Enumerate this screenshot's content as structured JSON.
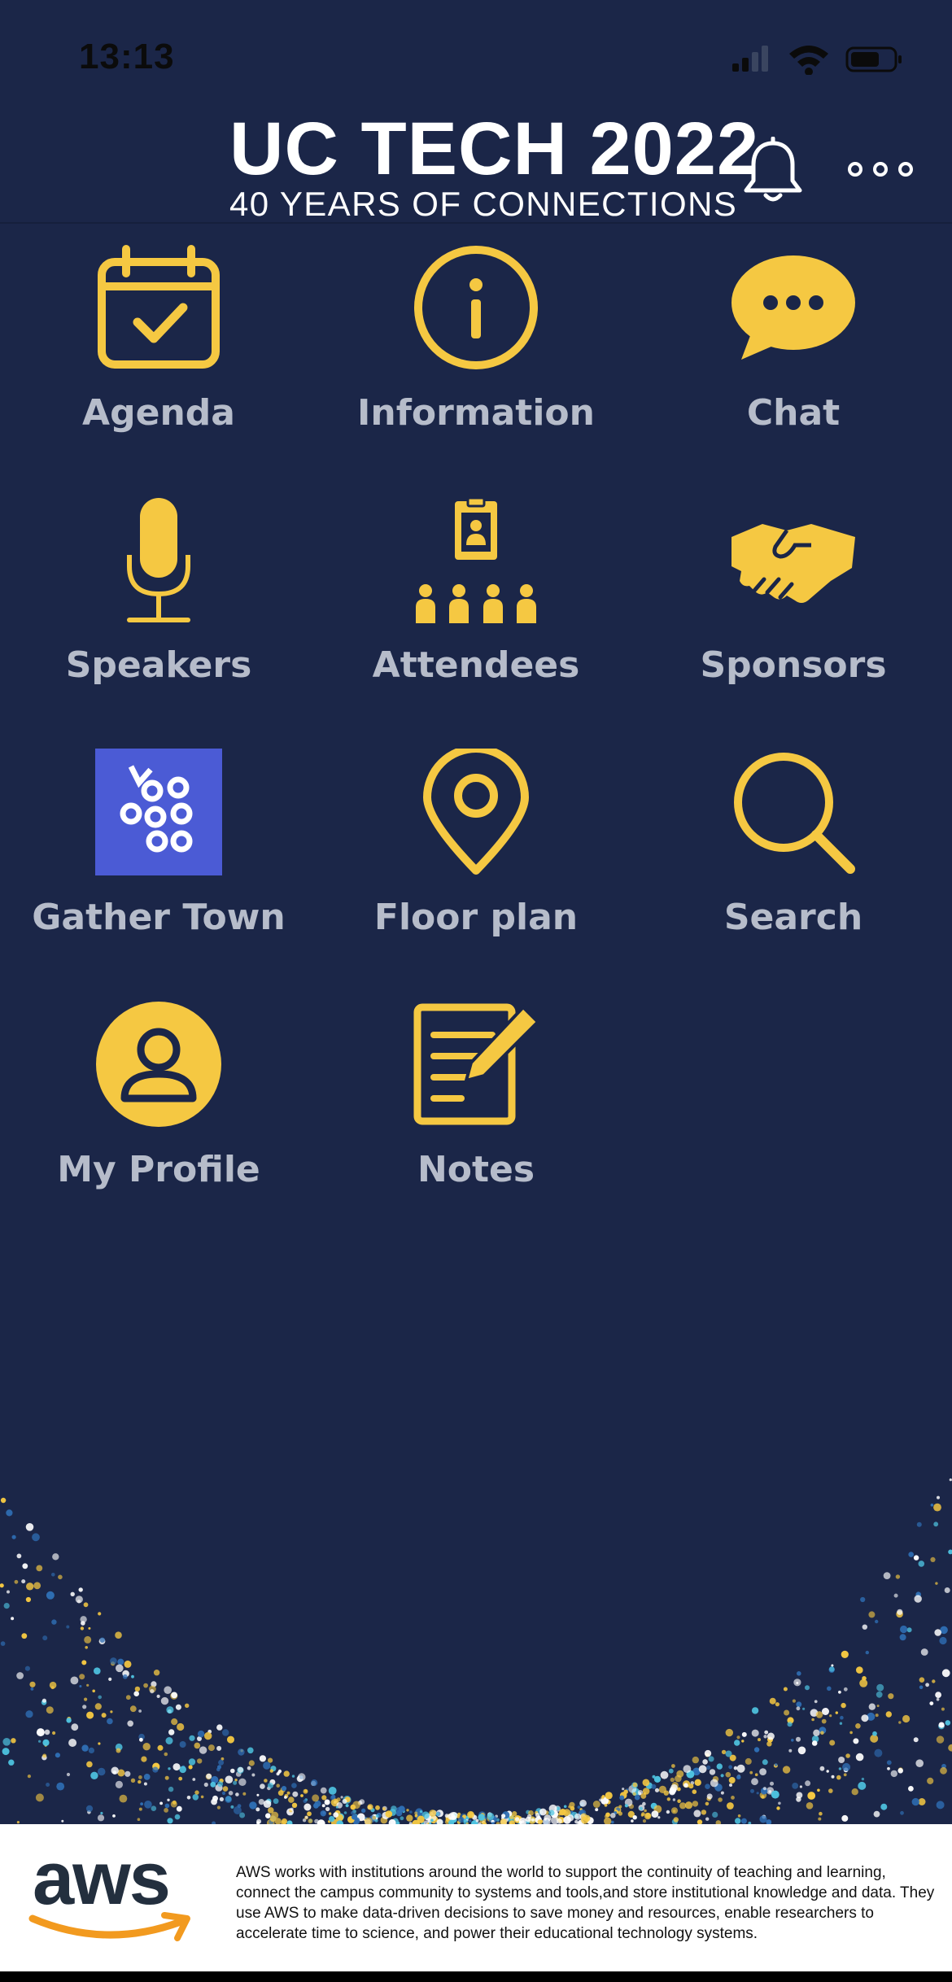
{
  "status_bar": {
    "time": "13:13"
  },
  "header": {
    "title": "UC TECH 2022",
    "subtitle": "40 YEARS OF CONNECTIONS"
  },
  "colors": {
    "background": "#1b2648",
    "accent": "#f5c842",
    "label": "#b6bcca",
    "gather_bg": "#4b5bd5"
  },
  "tiles": [
    {
      "label": "Agenda",
      "icon": "calendar-check-icon"
    },
    {
      "label": "Information",
      "icon": "info-circle-icon"
    },
    {
      "label": "Chat",
      "icon": "chat-bubble-icon"
    },
    {
      "label": "Speakers",
      "icon": "microphone-icon"
    },
    {
      "label": "Attendees",
      "icon": "attendees-badge-icon"
    },
    {
      "label": "Sponsors",
      "icon": "handshake-icon"
    },
    {
      "label": "Gather Town",
      "icon": "gather-town-logo-icon"
    },
    {
      "label": "Floor plan",
      "icon": "map-pin-icon"
    },
    {
      "label": "Search",
      "icon": "search-icon"
    },
    {
      "label": "My Profile",
      "icon": "user-circle-icon"
    },
    {
      "label": "Notes",
      "icon": "notes-edit-icon"
    }
  ],
  "footer": {
    "logo": "aws",
    "text": "AWS works with institutions around the world to support the continuity of teaching and learning, connect the campus community to systems and tools,and store institutional knowledge and data. They use AWS to make data-driven decisions to save money and resources, enable researchers to accelerate time to science, and power their educational technology systems."
  }
}
